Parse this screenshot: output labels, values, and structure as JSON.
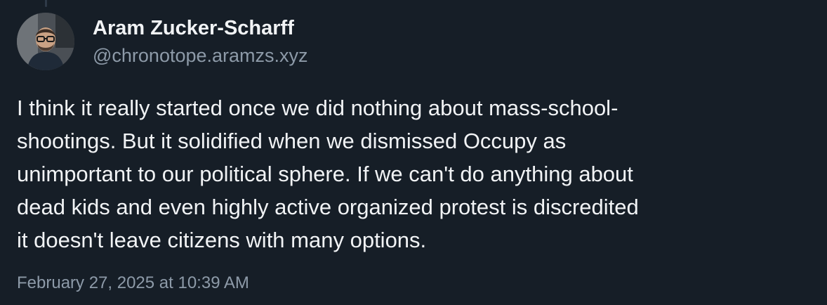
{
  "post": {
    "author": {
      "display_name": "Aram Zucker-Scharff",
      "handle": "@chronotope.aramzs.xyz",
      "avatar_icon": "user-avatar-photo"
    },
    "text_lines": [
      "I think it really started once we did nothing about mass-school-",
      "shootings. But it solidified when we dismissed Occupy as",
      "unimportant to our political sphere. If we can't do anything about",
      "dead kids and even highly active organized protest is discredited",
      "it doesn't leave citizens with many options."
    ],
    "timestamp": "February 27, 2025 at 10:39 AM"
  },
  "colors": {
    "background": "#161e27",
    "primary_text": "#f1f3f5",
    "secondary_text": "#8d9aa8",
    "thread_line": "#2e3a48"
  }
}
